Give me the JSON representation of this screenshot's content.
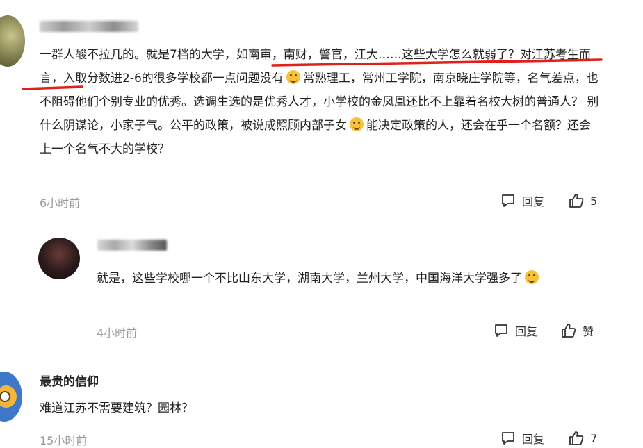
{
  "comments": [
    {
      "text_part1": "一群人酸不拉几的。就是7档的大学，如南审，南财，警官，江大……这些大学怎么就弱了？对江苏考生而言，入取分数进2-6的很多学校都一点问题没有",
      "text_part2": "常熟理工，常州工学院，南京晓庄学院等，名气差点，也不阻碍他们个别专业的优秀。选调生选的是优秀人才，小学校的金凤凰还比不上靠着名校大树的普通人？ 别什么阴谋论，小家子气。公平的政策，被说成照顾内部子女",
      "text_part3": "能决定政策的人，还会在乎一个名额？还会上一个名气不大的学校？",
      "time": "6小时前",
      "reply_label": "回复",
      "like_count": "5"
    },
    {
      "text": "就是，这些学校哪一个不比山东大学，湖南大学，兰州大学，中国海洋大学强多了",
      "time": "4小时前",
      "reply_label": "回复",
      "like_label": "赞"
    },
    {
      "username": "最贵的信仰",
      "text": "难道江苏不需要建筑？园林？",
      "time": "15小时前",
      "reply_label": "回复",
      "like_count": "7"
    }
  ],
  "icons": [
    "reply-icon",
    "thumbs-up-icon",
    "laugh-cry-emoji",
    "smile-emoji"
  ],
  "colors": {
    "underline": "#e0201a",
    "meta": "#9a9a9a",
    "text": "#222222"
  }
}
